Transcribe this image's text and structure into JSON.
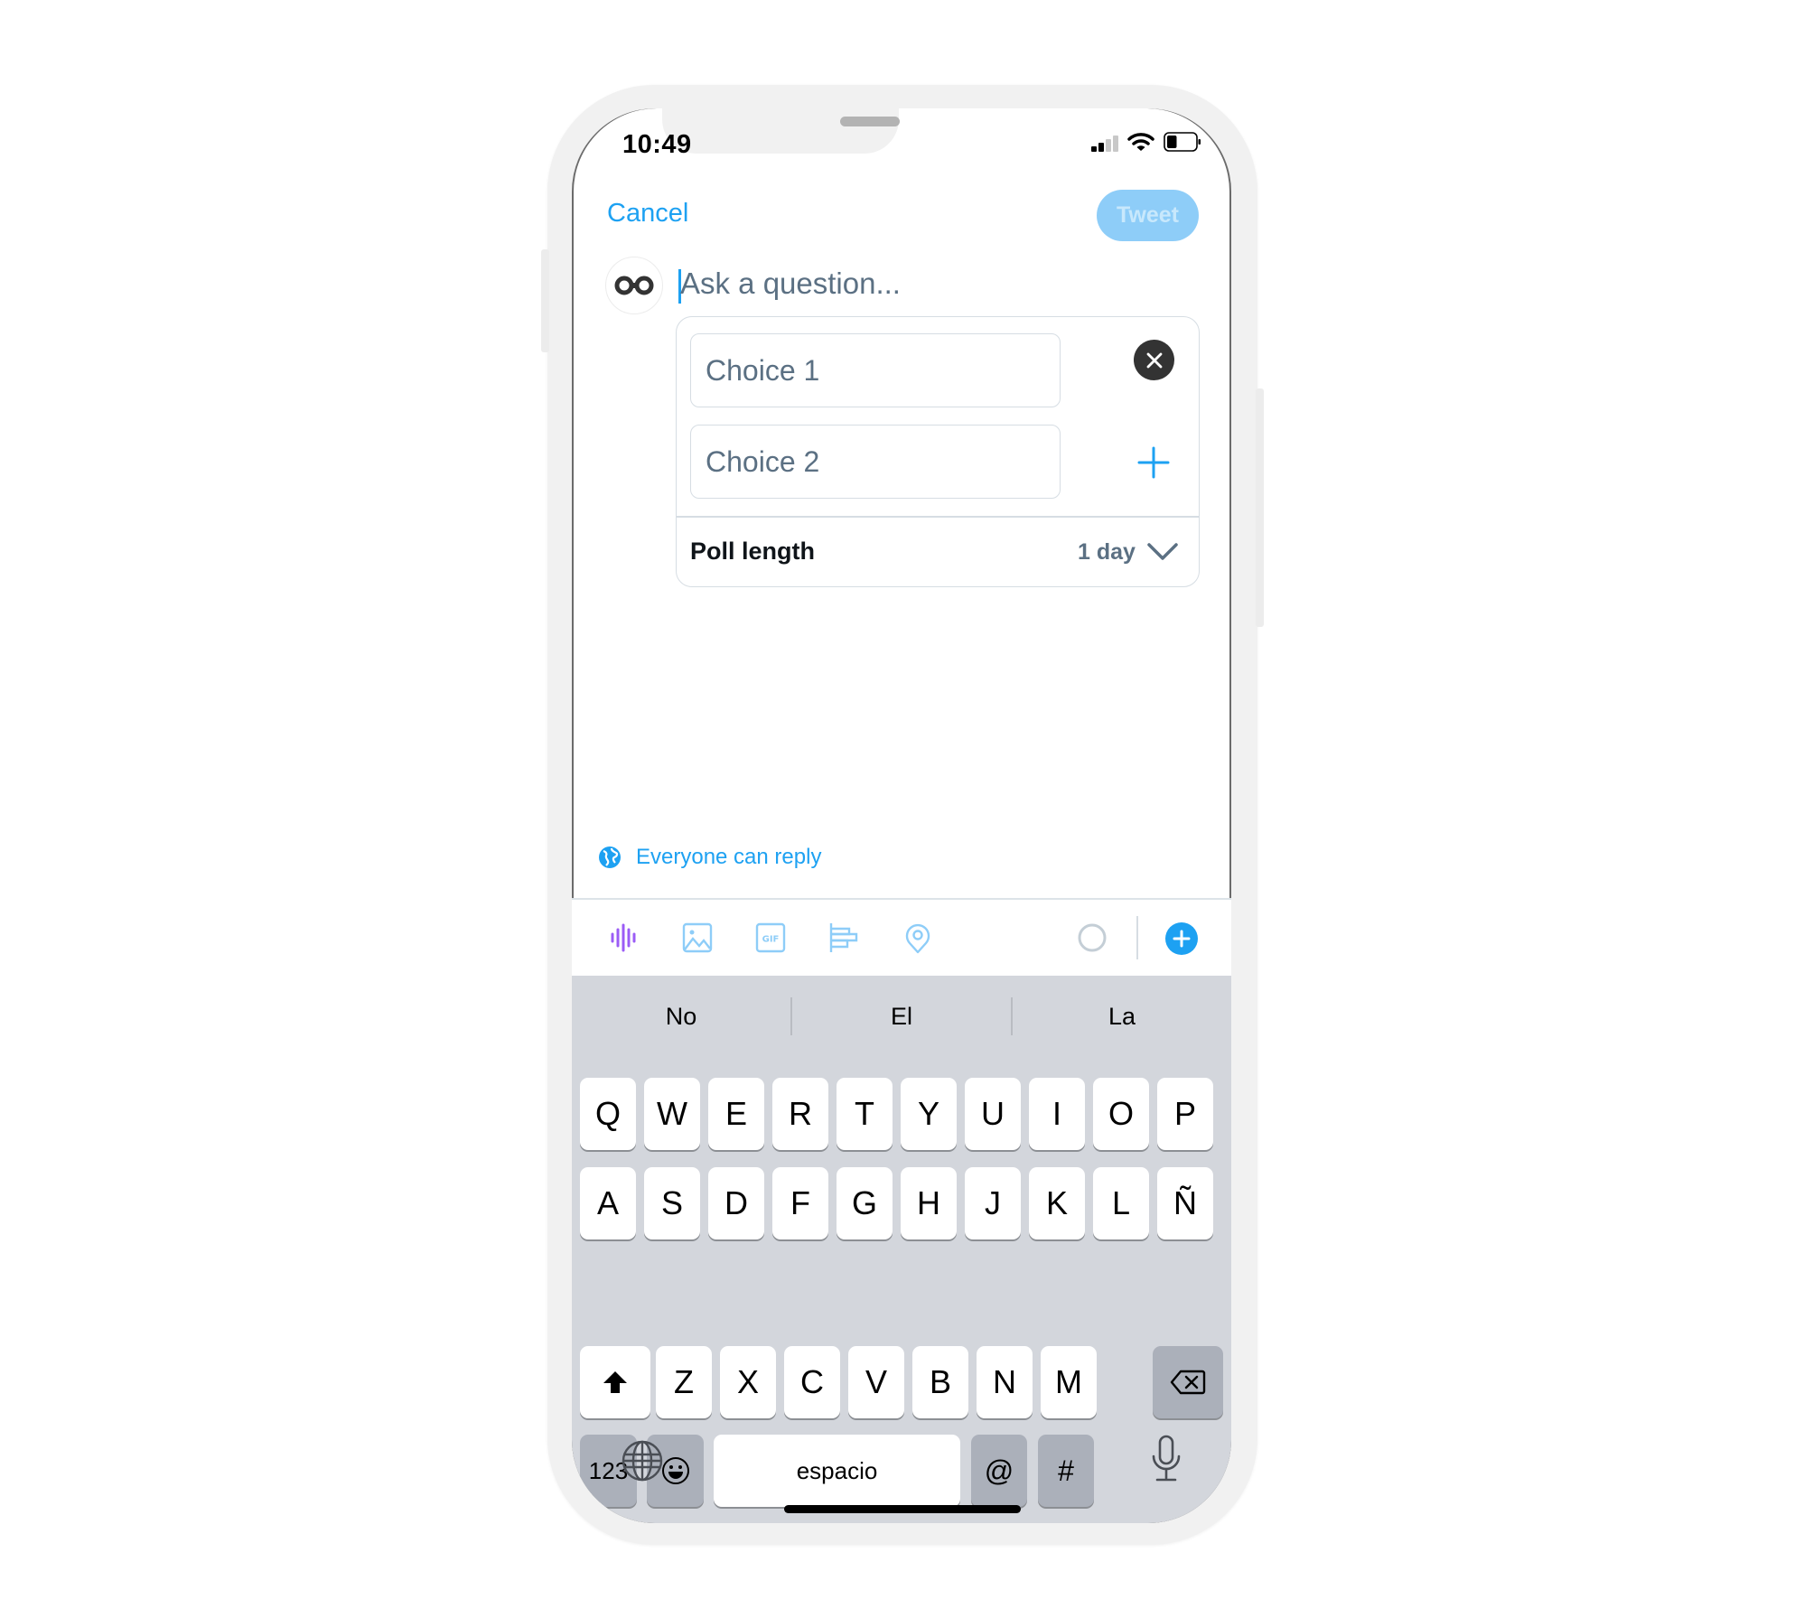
{
  "status_bar": {
    "time": "10:49",
    "signal_bars_active": 2,
    "signal_bars_total": 4,
    "battery_level": 0.35
  },
  "header": {
    "cancel_label": "Cancel",
    "tweet_label": "Tweet",
    "tweet_enabled": false
  },
  "composer": {
    "avatar_icon": "infinity-logo-icon",
    "question_placeholder": "Ask a question..."
  },
  "poll": {
    "choices": [
      {
        "placeholder": "Choice 1",
        "action_icon": "close-icon"
      },
      {
        "placeholder": "Choice 2",
        "action_icon": "plus-icon"
      }
    ],
    "length_label": "Poll length",
    "length_value": "1 day"
  },
  "reply_setting": {
    "icon": "globe-icon",
    "label": "Everyone can reply"
  },
  "toolbar": {
    "items": [
      {
        "icon": "voice-waveform-icon",
        "color": "#9b5cf6"
      },
      {
        "icon": "image-icon",
        "color": "#8ecdf8"
      },
      {
        "icon": "gif-icon",
        "label": "GIF",
        "color": "#8ecdf8"
      },
      {
        "icon": "poll-icon",
        "color": "#8ecdf8"
      },
      {
        "icon": "location-pin-icon",
        "color": "#8ecdf8"
      }
    ],
    "char_counter_progress": 0,
    "add_thread_icon": "plus-circle-icon"
  },
  "keyboard": {
    "suggestions": [
      "No",
      "El",
      "La"
    ],
    "row1": [
      "Q",
      "W",
      "E",
      "R",
      "T",
      "Y",
      "U",
      "I",
      "O",
      "P"
    ],
    "row2": [
      "A",
      "S",
      "D",
      "F",
      "G",
      "H",
      "J",
      "K",
      "L",
      "Ñ"
    ],
    "row3": [
      "Z",
      "X",
      "C",
      "V",
      "B",
      "N",
      "M"
    ],
    "numbers_label": "123",
    "space_label": "espacio",
    "at_label": "@",
    "hash_label": "#",
    "shift_icon": "shift-icon",
    "backspace_icon": "backspace-icon",
    "emoji_icon": "emoji-icon",
    "globe_icon": "globe-icon",
    "mic_icon": "microphone-icon"
  },
  "colors": {
    "accent": "#1da1f2",
    "tweet_button_disabled": "#8ecdf8",
    "placeholder_text": "#5b7083",
    "keyboard_bg": "#d3d6dc",
    "dark_key": "#abb0ba"
  }
}
